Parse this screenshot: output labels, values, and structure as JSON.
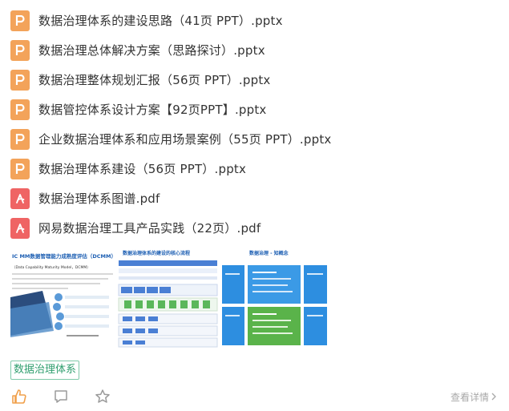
{
  "files": [
    {
      "type": "ppt",
      "icon": "ppt-file-icon",
      "name": "数据治理体系的建设思路（41页 PPT）.pptx"
    },
    {
      "type": "ppt",
      "icon": "ppt-file-icon",
      "name": "数据治理总体解决方案（思路探讨）.pptx"
    },
    {
      "type": "ppt",
      "icon": "ppt-file-icon",
      "name": "数据治理整体规划汇报（56页 PPT）.pptx"
    },
    {
      "type": "ppt",
      "icon": "ppt-file-icon",
      "name": "数据管控体系设计方案【92页PPT】.pptx"
    },
    {
      "type": "ppt",
      "icon": "ppt-file-icon",
      "name": "企业数据治理体系和应用场景案例（55页 PPT）.pptx"
    },
    {
      "type": "ppt",
      "icon": "ppt-file-icon",
      "name": "数据治理体系建设（56页 PPT）.pptx"
    },
    {
      "type": "pdf",
      "icon": "pdf-file-icon",
      "name": "数据治理体系图谱.pdf"
    },
    {
      "type": "pdf",
      "icon": "pdf-file-icon",
      "name": "网易数据治理工具产品实践（22页）.pdf"
    }
  ],
  "thumbnails": [
    {
      "title": "IC MM数据管理能力成熟度评估（DCMM）",
      "subtitle": "（Data Capability Maturity Model，DCMM）"
    },
    {
      "title": "数据治理体系的建设的核心流程"
    },
    {
      "title": "数据治理 - 知概念"
    }
  ],
  "tag": "数据治理体系",
  "actions": {
    "like": "thumbs-up-icon",
    "comment": "comment-icon",
    "favorite": "star-icon"
  },
  "details_label": "查看详情",
  "colors": {
    "ppt": "#f3a35a",
    "pdf": "#ef6464",
    "tag": "#2f9e6e",
    "like": "#f0a04b"
  }
}
